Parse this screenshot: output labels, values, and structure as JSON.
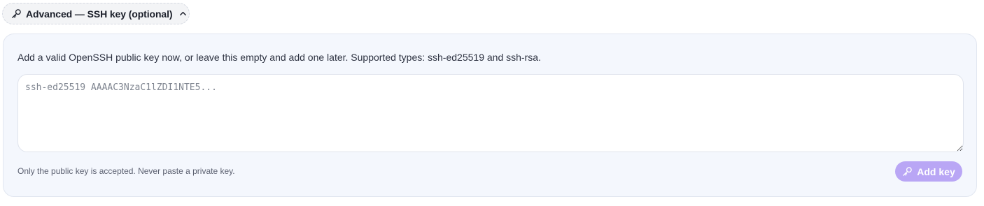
{
  "toggle": {
    "label": "Advanced — SSH key (optional)",
    "icon": "key-icon",
    "chevron_icon": "chevron-up-icon",
    "expanded": true
  },
  "panel": {
    "help_text": "Add a valid OpenSSH public key now, or leave this empty and add one later. Supported types: ssh-ed25519 and ssh-rsa.",
    "textarea": {
      "value": "",
      "placeholder": "ssh-ed25519 AAAAC3NzaC1lZDI1NTE5..."
    },
    "footnote": "Only the public key is accepted. Never paste a private key.",
    "add_button": {
      "label": "Add key",
      "icon": "key-icon",
      "disabled": true
    }
  },
  "colors": {
    "accent_disabled": "#b9a6f5",
    "panel_bg": "#f4f7fd",
    "pill_bg": "#f3f4f6"
  }
}
